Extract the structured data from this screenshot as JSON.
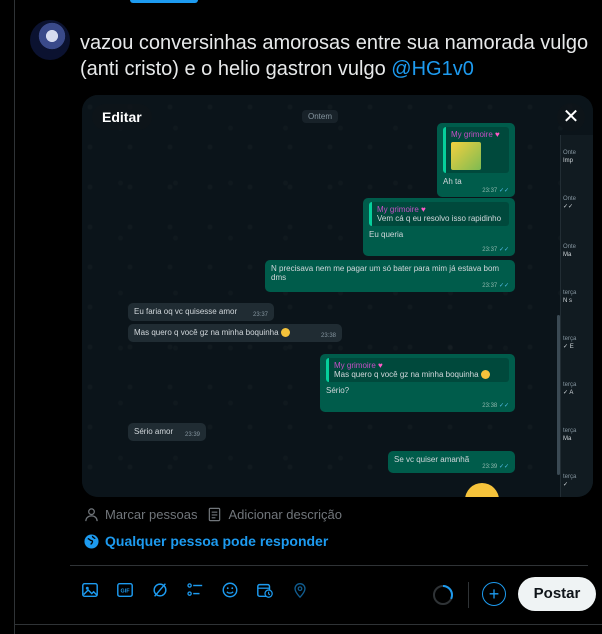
{
  "tweet": {
    "text": "vazou conversinhas amorosas entre sua namorada vulgo (anti cristo) e o helio gastron vulgo ",
    "mention": "@HG1v0"
  },
  "media": {
    "edit_label": "Editar",
    "close_glyph": "✕",
    "date_chip": "Ontem",
    "messages": [
      {
        "quote_name": "My grimoire",
        "text": "Ah ta",
        "time": "23:37"
      },
      {
        "quote_name": "My grimoire",
        "quote_text": "Vem cá q eu resolvo isso rapidinho",
        "text": "Eu queria",
        "time": "23:37"
      },
      {
        "text": "N precisava nem me pagar um só bater para mim já estava bom dms",
        "time": "23:37"
      },
      {
        "text": "Eu faria oq vc quisesse amor",
        "time": "23:37"
      },
      {
        "text": "Mas quero q você gz na minha boquinha",
        "time": "23:38"
      },
      {
        "quote_name": "My grimoire",
        "quote_text": "Mas quero q você gz na minha boquinha",
        "text": "Sério?",
        "time": "23:38"
      },
      {
        "text": "Sério amor",
        "time": "23:39"
      },
      {
        "text": "Se vc quiser amanhã",
        "time": "23:39"
      }
    ],
    "side": [
      {
        "day": "Onte",
        "line": "Imp"
      },
      {
        "day": "Onte",
        "line": "✓✓"
      },
      {
        "day": "Onte",
        "line": "Ma"
      },
      {
        "day": "terça",
        "line": "N s"
      },
      {
        "day": "terça",
        "line": "✓ E"
      },
      {
        "day": "terça",
        "line": "✓ A"
      },
      {
        "day": "terça",
        "line": "Ma"
      },
      {
        "day": "terça",
        "line": "✓"
      }
    ]
  },
  "tools": {
    "tag_people": "Marcar pessoas",
    "add_description": "Adicionar descrição"
  },
  "reply_setting": "Qualquer pessoa pode responder",
  "toolbar_icons": [
    "image-icon",
    "gif-icon",
    "grok-icon",
    "poll-icon",
    "emoji-icon",
    "schedule-icon",
    "location-icon"
  ],
  "post_label": "Postar",
  "colors": {
    "accent": "#1d9bf0",
    "background": "#000000",
    "chat_out": "#005c4b",
    "chat_in": "#202c33"
  }
}
